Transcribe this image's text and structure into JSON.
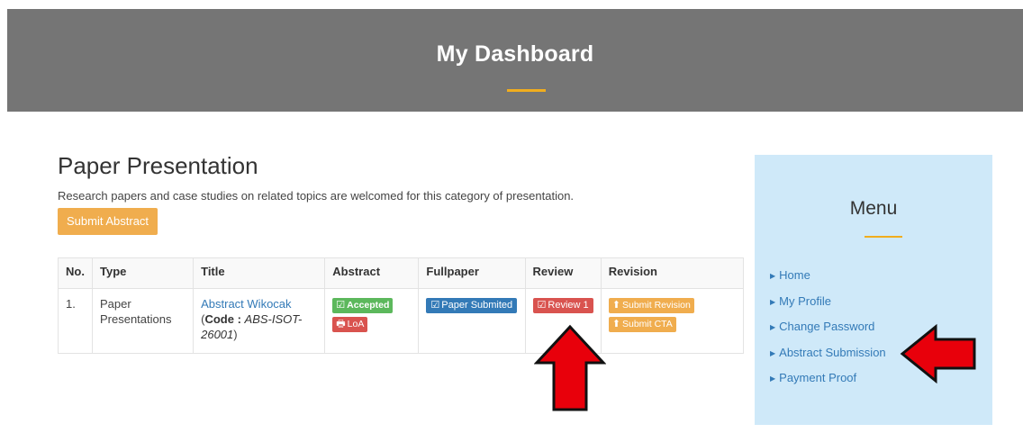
{
  "header": {
    "title": "My Dashboard"
  },
  "main": {
    "title": "Paper Presentation",
    "description": "Research papers and case studies on related topics are welcomed for this category of presentation.",
    "submit_label": "Submit Abstract"
  },
  "table": {
    "headers": [
      "No.",
      "Type",
      "Title",
      "Abstract",
      "Fullpaper",
      "Review",
      "Revision"
    ],
    "rows": [
      {
        "no": "1.",
        "type_line1": "Paper",
        "type_line2": "Presentations",
        "title_link": "Abstract Wikocak",
        "code_label": "Code :",
        "code_value_line1": "ABS-ISOT-",
        "code_value_line2": "26001",
        "abstract_status": "Accepted",
        "abstract_loa": "LoA",
        "fullpaper_status": "Paper Submited",
        "review_label": "Review 1",
        "revision_submit": "Submit Revision",
        "revision_cta": "Submit CTA"
      }
    ]
  },
  "sidebar": {
    "title": "Menu",
    "items": [
      {
        "label": "Home"
      },
      {
        "label": "My Profile"
      },
      {
        "label": "Change Password"
      },
      {
        "label": "Abstract Submission"
      },
      {
        "label": "Payment Proof"
      }
    ]
  },
  "colors": {
    "header_bg": "#757575",
    "accent": "#f0ad1e",
    "sidebar_bg": "#cfe9f9",
    "link": "#337ab7",
    "arrow_red": "#e8000b"
  },
  "icons": {
    "accepted": "check-square-icon",
    "loa": "printer-icon",
    "paper": "check-square-icon",
    "review": "check-square-icon",
    "revision": "upload-circle-icon",
    "menu_caret": "caret-right-icon",
    "annotation": "red-arrow-icon"
  }
}
